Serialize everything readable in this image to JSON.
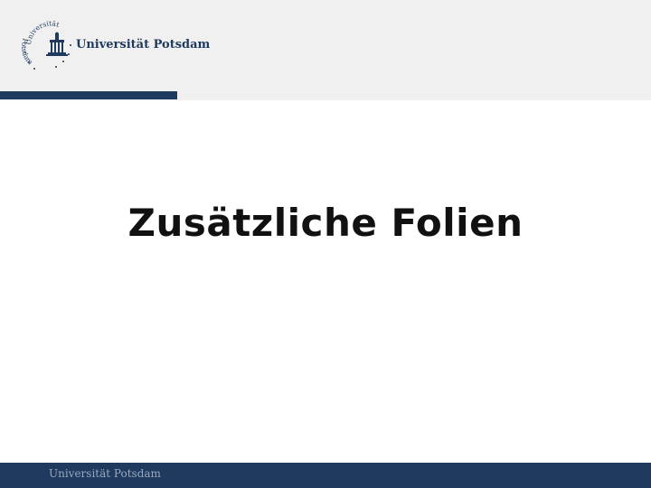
{
  "colors": {
    "header_bg": "#f0f0f0",
    "brand_navy": "#1f3a5f",
    "title_text": "#111111",
    "footer_text": "#9ba9bf"
  },
  "logo": {
    "icon": "university-seal-icon",
    "arc_top": "Universität",
    "arc_bottom": "Potsdam",
    "wordmark": "Universität Potsdam"
  },
  "slide": {
    "title": "Zusätzliche Folien"
  },
  "footer": {
    "text": "Universität Potsdam"
  }
}
